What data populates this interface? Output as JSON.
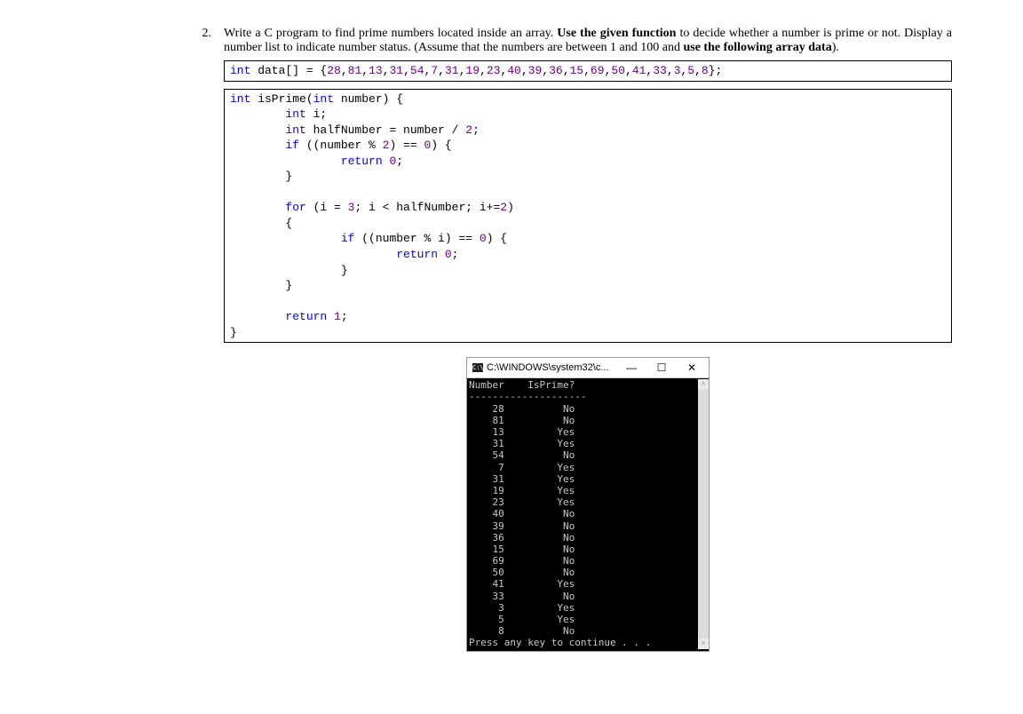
{
  "question": {
    "number": "2.",
    "text_part1": "Write a C program to find prime numbers located inside an array. ",
    "bold1": "Use the given function",
    "text_part2": " to decide whether a number is prime or not. Display a number list to indicate number status. (Assume that the numbers are between 1 and 100 and ",
    "bold2": "use the following array data",
    "text_part3": ")."
  },
  "code_line": "int data[] = {28,81,13,31,54,7,31,19,23,40,39,36,15,69,50,41,33,3,5,8};",
  "func_code": "int isPrime(int number) {\n        int i;\n        int halfNumber = number / 2;\n        if ((number % 2) == 0) {\n                return 0;\n        }\n\n        for (i = 3; i < halfNumber; i+=2)\n        {\n                if ((number % i) == 0) {\n                        return 0;\n                }\n        }\n\n        return 1;\n}",
  "console": {
    "icon_text": "C:\\",
    "title": "C:\\WINDOWS\\system32\\c...",
    "min_label": "—",
    "max_label": "☐",
    "close_label": "✕",
    "header": "Number    IsPrime?",
    "divider": "--------------------",
    "rows": [
      {
        "n": "28",
        "p": "No"
      },
      {
        "n": "81",
        "p": "No"
      },
      {
        "n": "13",
        "p": "Yes"
      },
      {
        "n": "31",
        "p": "Yes"
      },
      {
        "n": "54",
        "p": "No"
      },
      {
        "n": "7",
        "p": "Yes"
      },
      {
        "n": "31",
        "p": "Yes"
      },
      {
        "n": "19",
        "p": "Yes"
      },
      {
        "n": "23",
        "p": "Yes"
      },
      {
        "n": "40",
        "p": "No"
      },
      {
        "n": "39",
        "p": "No"
      },
      {
        "n": "36",
        "p": "No"
      },
      {
        "n": "15",
        "p": "No"
      },
      {
        "n": "69",
        "p": "No"
      },
      {
        "n": "50",
        "p": "No"
      },
      {
        "n": "41",
        "p": "Yes"
      },
      {
        "n": "33",
        "p": "No"
      },
      {
        "n": "3",
        "p": "Yes"
      },
      {
        "n": "5",
        "p": "Yes"
      },
      {
        "n": "8",
        "p": "No"
      }
    ],
    "footer": "Press any key to continue . . .",
    "scroll_up": "˄",
    "scroll_down": "˅"
  }
}
